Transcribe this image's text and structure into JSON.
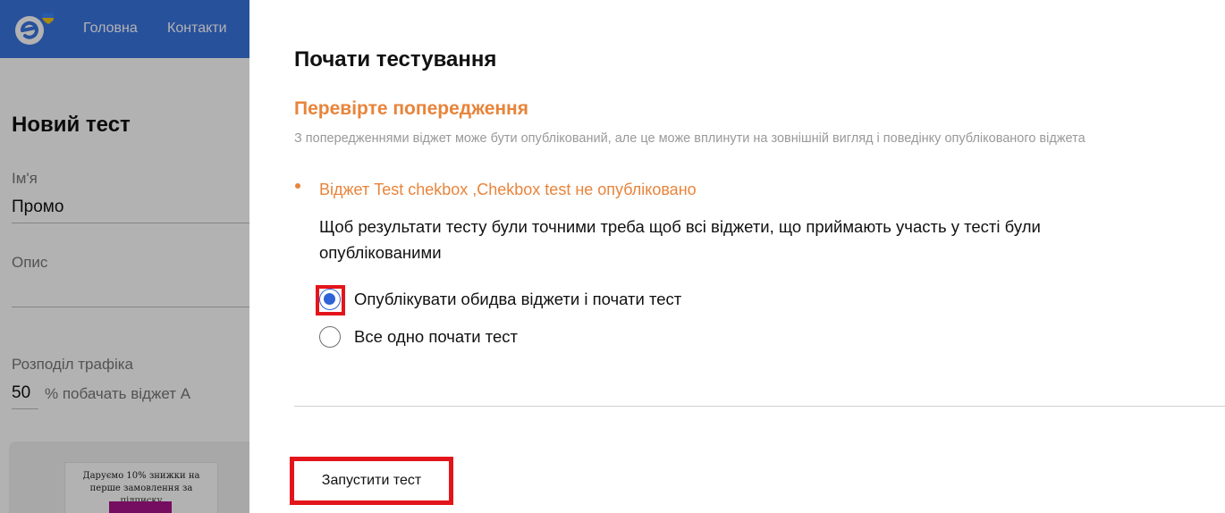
{
  "header": {
    "nav": [
      {
        "label": "Головна"
      },
      {
        "label": "Контакти"
      }
    ],
    "brand_color": "#3a74e0"
  },
  "background_form": {
    "title": "Новий тест",
    "name_label": "Ім'я",
    "name_value": "Промо",
    "description_label": "Опис",
    "traffic_label": "Розподіл трафіка",
    "traffic_value": "50",
    "traffic_suffix": "% побачать віджет А",
    "preview_text": "Даруємо 10% знижки на перше замовлення за підписку"
  },
  "modal": {
    "title": "Почати тестування",
    "warning_heading": "Перевірте попередження",
    "warning_description": "З попередженнями віджет може бути опублікований, але це може вплинути на зовнішній вигляд і поведінку опублікованого віджета",
    "warning_item": "Віджет Test chekbox ,Chekbox test не опубліковано",
    "explanation": "Щоб результати тесту були точними треба щоб всі віджети, що приймають участь у тесті були опублікованими",
    "options": [
      {
        "label": "Опублікувати обидва віджети і почати тест",
        "selected": true
      },
      {
        "label": "Все одно почати тест",
        "selected": false
      }
    ],
    "start_button": "Запустити тест",
    "accent_color": "#e8843a",
    "radio_color": "#2e62d6",
    "highlight_color": "#e3151a"
  }
}
